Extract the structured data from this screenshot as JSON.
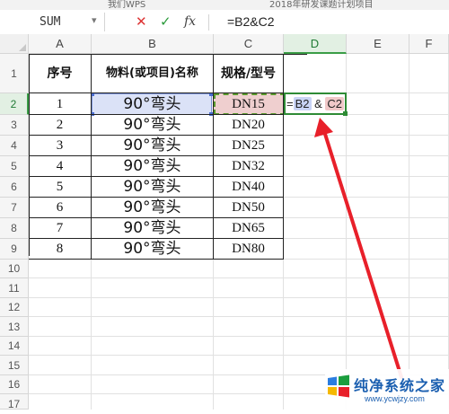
{
  "title_strip": {
    "left_text": "SUM",
    "mid_text": "我们WPS",
    "right_text": "2018年研发课题计划项目"
  },
  "formula_bar": {
    "name_box": "SUM",
    "cancel_icon": "cross-icon",
    "enter_icon": "check-icon",
    "fx_label": "fx",
    "formula": "=B2&C2"
  },
  "columns": [
    "A",
    "B",
    "C",
    "D",
    "E",
    "F"
  ],
  "active_column": "D",
  "rows": [
    "1",
    "2",
    "3",
    "4",
    "5",
    "6",
    "7",
    "8",
    "9",
    "10",
    "11",
    "12",
    "13",
    "14",
    "15",
    "16",
    "17"
  ],
  "active_row": "2",
  "table": {
    "headers": [
      "序号",
      "物料(或项目)名称",
      "规格/型号"
    ],
    "items": [
      {
        "no": "1",
        "name": "90°弯头",
        "spec": "DN15"
      },
      {
        "no": "2",
        "name": "90°弯头",
        "spec": "DN20"
      },
      {
        "no": "3",
        "name": "90°弯头",
        "spec": "DN25"
      },
      {
        "no": "4",
        "name": "90°弯头",
        "spec": "DN32"
      },
      {
        "no": "5",
        "name": "90°弯头",
        "spec": "DN40"
      },
      {
        "no": "6",
        "name": "90°弯头",
        "spec": "DN50"
      },
      {
        "no": "7",
        "name": "90°弯头",
        "spec": "DN65"
      },
      {
        "no": "8",
        "name": "90°弯头",
        "spec": "DN80"
      }
    ]
  },
  "editing_cell": {
    "prefix": "=",
    "ref1": "B2",
    "op": "&",
    "ref2": "C2"
  },
  "colors": {
    "accent_green": "#2e8b35",
    "ref_blue": "#dbe2f7",
    "ref_red": "#efcfcf",
    "arrow_red": "#e8202a"
  },
  "watermark": {
    "title": "纯净系统之家",
    "url": "www.ycwjzy.com"
  }
}
